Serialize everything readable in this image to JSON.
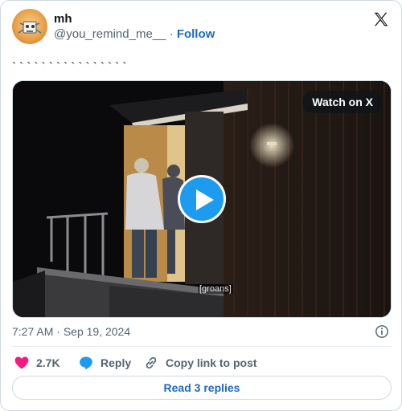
{
  "author": {
    "name": "mh",
    "handle": "@you_remind_me__",
    "separator": "·",
    "follow_label": "Follow"
  },
  "tweet": {
    "text": "` ` ` ` ` ` ` ` ` ` ` ` ` ` ` `"
  },
  "media": {
    "watch_label": "Watch on X",
    "caption": "[groans]",
    "play_icon": "play-icon"
  },
  "meta": {
    "time": "7:27 AM",
    "dot": "·",
    "date": "Sep 19, 2024"
  },
  "actions": {
    "like_count": "2.7K",
    "reply_label": "Reply",
    "copy_label": "Copy link to post"
  },
  "footer": {
    "read_replies_label": "Read 3 replies"
  },
  "colors": {
    "link": "#1d68c8",
    "like": "#f91880",
    "reply": "#1d9bf0",
    "muted": "#536471"
  }
}
